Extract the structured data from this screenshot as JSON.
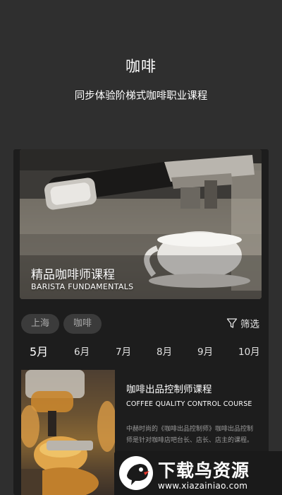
{
  "header": {
    "title": "咖啡",
    "subtitle": "同步体验阶梯式咖啡职业课程"
  },
  "hero": {
    "title": "精品咖啡师课程",
    "subtitle": "BARISTA FUNDAMENTALS"
  },
  "filters": {
    "tags": [
      "上海",
      "咖啡"
    ],
    "filter_label": "筛选",
    "filter_icon": "funnel-icon"
  },
  "months": {
    "items": [
      "5月",
      "6月",
      "7月",
      "8月",
      "9月",
      "10月"
    ],
    "selected": "5月"
  },
  "course": {
    "title": "咖啡出品控制师课程",
    "subtitle": "COFFEE QUALITY CONTROL COURSE",
    "description": "中赫时尚的《咖啡出品控制师》咖啡出品控制师是针对咖啡店吧台长、店长、店主的课程。"
  },
  "watermark": {
    "text": "下载鸟资源",
    "url": "www.xiazainiao.com",
    "logo_icon": "bird-logo-icon"
  },
  "colors": {
    "background": "#2f2f2f",
    "card": "#1d1d1d",
    "tag_bg": "#3b3b3b"
  }
}
